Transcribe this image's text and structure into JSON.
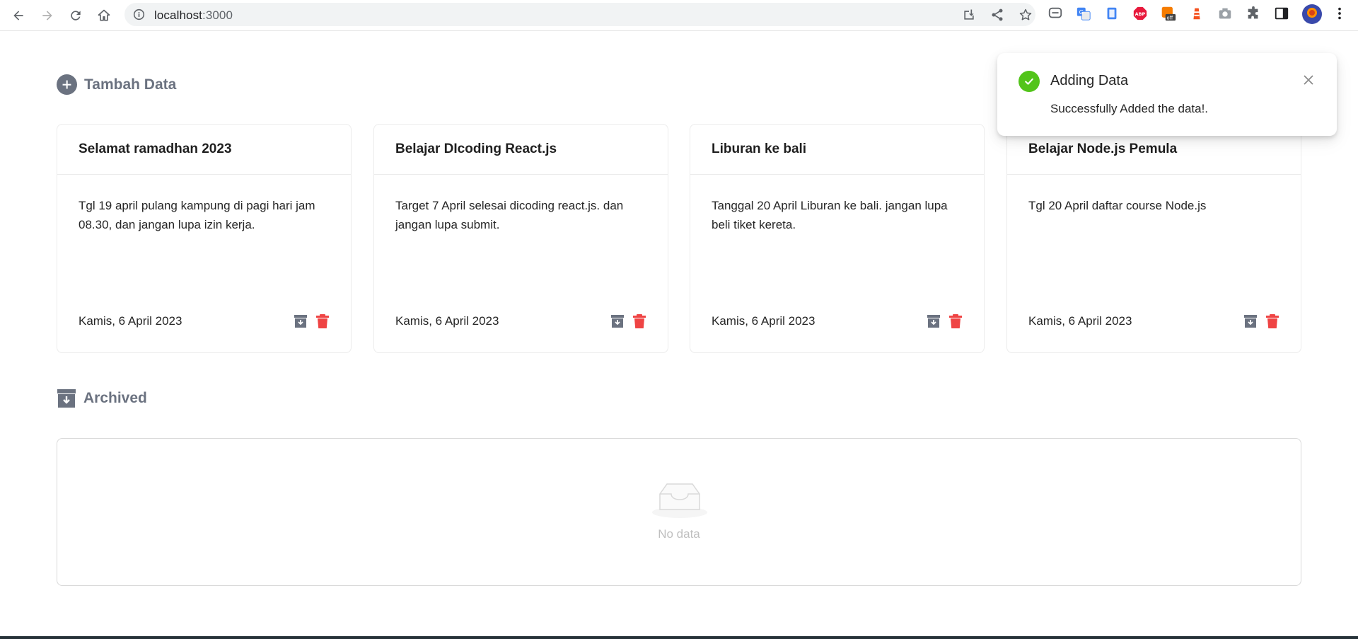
{
  "browser": {
    "url_host": "localhost",
    "url_port": ":3000"
  },
  "header": {
    "add_label": "Tambah Data"
  },
  "notes": [
    {
      "title": "Selamat ramadhan 2023",
      "body": "Tgl 19 april pulang kampung di pagi hari jam 08.30, dan jangan lupa izin kerja.",
      "date": "Kamis, 6 April 2023"
    },
    {
      "title": "Belajar DIcoding React.js",
      "body": "Target 7 April selesai dicoding react.js. dan jangan lupa submit.",
      "date": "Kamis, 6 April 2023"
    },
    {
      "title": "Liburan ke bali",
      "body": "Tanggal 20 April Liburan ke bali. jangan lupa beli tiket kereta.",
      "date": "Kamis, 6 April 2023"
    },
    {
      "title": "Belajar Node.js Pemula",
      "body": "Tgl 20 April daftar course Node.js",
      "date": "Kamis, 6 April 2023"
    }
  ],
  "archived": {
    "label": "Archived",
    "empty_text": "No data"
  },
  "notification": {
    "title": "Adding Data",
    "description": "Successfully Added the data!."
  },
  "colors": {
    "success": "#52c41a",
    "delete": "#ef4444",
    "muted": "#6b7280"
  }
}
